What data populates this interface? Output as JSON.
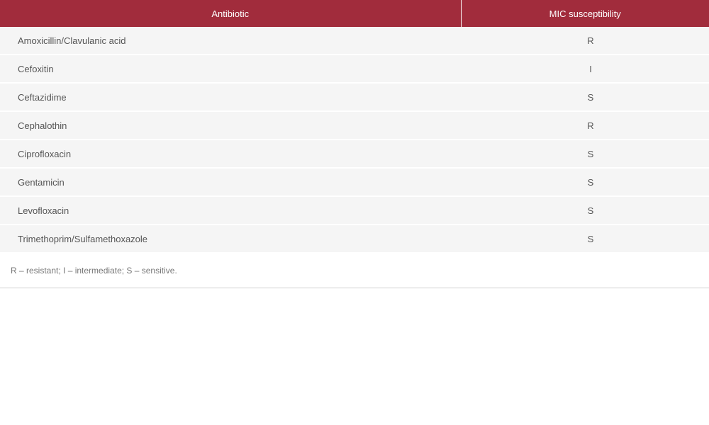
{
  "table": {
    "headers": [
      "Antibiotic",
      "MIC susceptibility"
    ],
    "rows": [
      {
        "antibiotic": "Amoxicillin/Clavulanic acid",
        "mic": "R"
      },
      {
        "antibiotic": "Cefoxitin",
        "mic": "I"
      },
      {
        "antibiotic": "Ceftazidime",
        "mic": "S"
      },
      {
        "antibiotic": "Cephalothin",
        "mic": "R"
      },
      {
        "antibiotic": "Ciprofloxacin",
        "mic": "S"
      },
      {
        "antibiotic": "Gentamicin",
        "mic": "S"
      },
      {
        "antibiotic": "Levofloxacin",
        "mic": "S"
      },
      {
        "antibiotic": "Trimethoprim/Sulfamethoxazole",
        "mic": "S"
      }
    ]
  },
  "footnote": "R – resistant; I – intermediate; S – sensitive.",
  "colors": {
    "header_bg": "#a12c3c",
    "row_bg": "#f5f5f5"
  }
}
